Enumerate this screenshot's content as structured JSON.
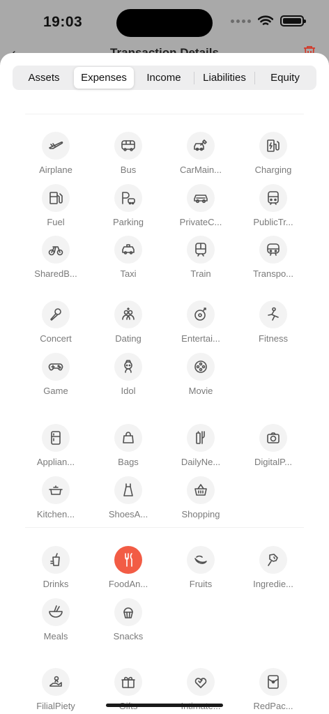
{
  "status": {
    "time": "19:03"
  },
  "nav": {
    "back": "‹",
    "title": "Transaction Details"
  },
  "tabs": [
    {
      "label": "Assets"
    },
    {
      "label": "Expenses"
    },
    {
      "label": "Income"
    },
    {
      "label": "Liabilities"
    },
    {
      "label": "Equity"
    }
  ],
  "active_tab": "Expenses",
  "selected_category": "FoodAn...",
  "colors": {
    "accent": "#f25c45",
    "icon": "#505050",
    "label": "#7a7a7a"
  },
  "groups": [
    {
      "items": [
        {
          "label": "Airplane",
          "icon": "airplane-icon"
        },
        {
          "label": "Bus",
          "icon": "bus-icon"
        },
        {
          "label": "CarMain...",
          "icon": "car-maintenance-icon"
        },
        {
          "label": "Charging",
          "icon": "charging-icon"
        },
        {
          "label": "Fuel",
          "icon": "fuel-icon"
        },
        {
          "label": "Parking",
          "icon": "parking-icon"
        },
        {
          "label": "PrivateC...",
          "icon": "private-car-icon"
        },
        {
          "label": "PublicTr...",
          "icon": "public-transit-icon"
        },
        {
          "label": "SharedB...",
          "icon": "shared-bike-icon"
        },
        {
          "label": "Taxi",
          "icon": "taxi-icon"
        },
        {
          "label": "Train",
          "icon": "train-icon"
        },
        {
          "label": "Transpo...",
          "icon": "transport-icon"
        }
      ]
    },
    {
      "items": [
        {
          "label": "Concert",
          "icon": "microphone-icon"
        },
        {
          "label": "Dating",
          "icon": "dating-icon"
        },
        {
          "label": "Entertai...",
          "icon": "entertainment-icon"
        },
        {
          "label": "Fitness",
          "icon": "fitness-icon"
        },
        {
          "label": "Game",
          "icon": "gamepad-icon"
        },
        {
          "label": "Idol",
          "icon": "idol-icon"
        },
        {
          "label": "Movie",
          "icon": "film-reel-icon"
        }
      ]
    },
    {
      "items": [
        {
          "label": "Applian...",
          "icon": "fridge-icon"
        },
        {
          "label": "Bags",
          "icon": "bag-icon"
        },
        {
          "label": "DailyNe...",
          "icon": "daily-needs-icon"
        },
        {
          "label": "DigitalP...",
          "icon": "camera-icon"
        },
        {
          "label": "Kitchen...",
          "icon": "pot-icon"
        },
        {
          "label": "ShoesA...",
          "icon": "dress-icon"
        },
        {
          "label": "Shopping",
          "icon": "basket-icon"
        }
      ]
    },
    {
      "items": [
        {
          "label": "Drinks",
          "icon": "drinks-icon"
        },
        {
          "label": "FoodAn...",
          "icon": "fork-knife-icon"
        },
        {
          "label": "Fruits",
          "icon": "banana-icon"
        },
        {
          "label": "Ingredie...",
          "icon": "ingredients-icon"
        },
        {
          "label": "Meals",
          "icon": "bowl-icon"
        },
        {
          "label": "Snacks",
          "icon": "cupcake-icon"
        }
      ]
    },
    {
      "items": [
        {
          "label": "FilialPiety",
          "icon": "filial-piety-icon"
        },
        {
          "label": "Gifts",
          "icon": "gift-icon"
        },
        {
          "label": "Intimate...",
          "icon": "hearts-icon"
        },
        {
          "label": "RedPac...",
          "icon": "red-packet-icon"
        }
      ]
    }
  ]
}
